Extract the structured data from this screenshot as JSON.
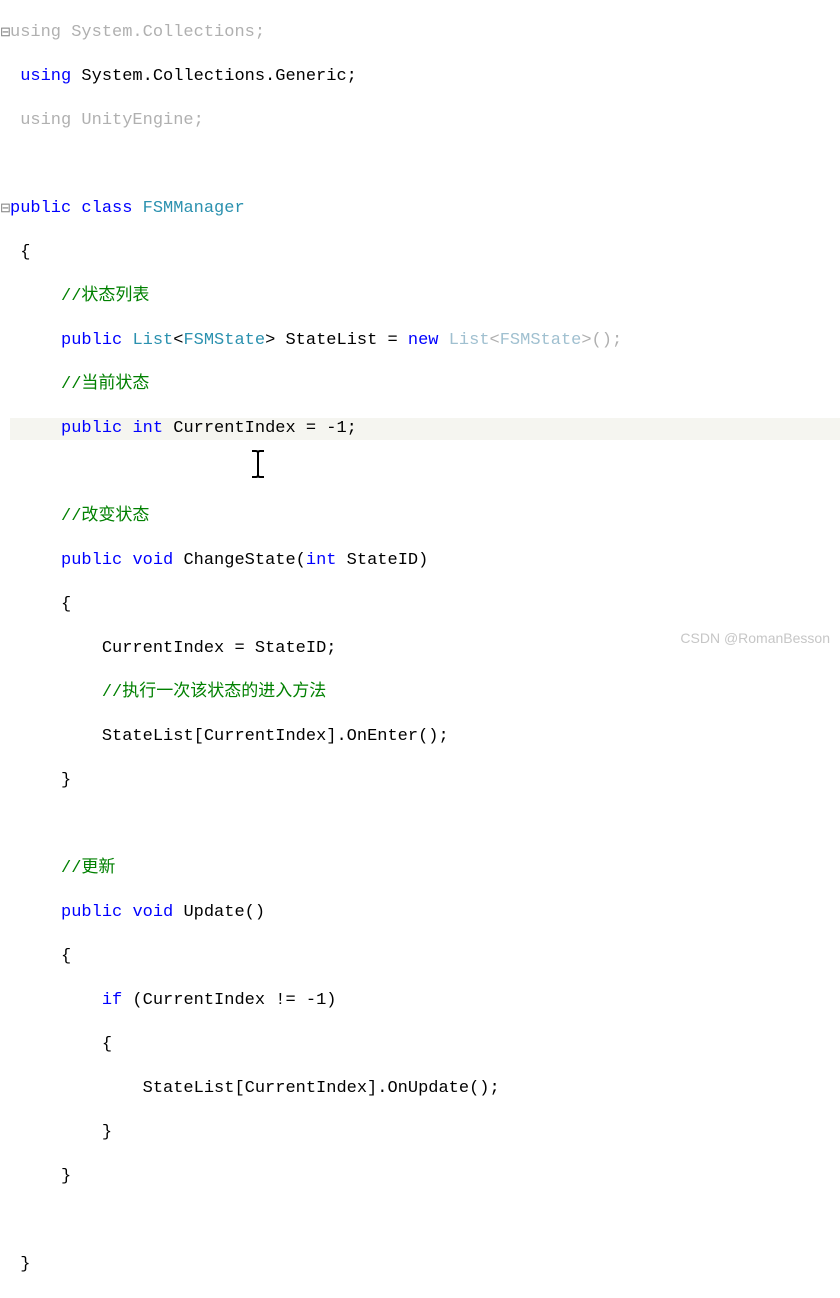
{
  "code": {
    "using1_kw": "using",
    "using1_ns": " System.Collections;",
    "using2_kw": "using",
    "using2_ns": " System.Collections.Generic;",
    "using3_kw": "using",
    "using3_ns": " UnityEngine;",
    "class_public": "public",
    "class_kw": " class ",
    "class_name": "FSMManager",
    "brace_open": "{",
    "comment1": "//状态列表",
    "field1_public": "public ",
    "field1_type": "List",
    "field1_lt": "<",
    "field1_generic": "FSMState",
    "field1_gt": "> StateList = ",
    "field1_new": "new",
    "field1_list": " List",
    "field1_lt2": "<",
    "field1_generic2": "FSMState",
    "field1_end": ">();",
    "comment2": "//当前状态",
    "field2_public": "public ",
    "field2_int": "int",
    "field2_rest": " CurrentIndex = -1;",
    "comment3": "//改变状态",
    "method1_public": "public ",
    "method1_void": "void",
    "method1_name": " ChangeState(",
    "method1_int": "int",
    "method1_param": " StateID)",
    "method1_body1": "CurrentIndex = StateID;",
    "method1_comment": "//执行一次该状态的进入方法",
    "method1_body2": "StateList[CurrentIndex].OnEnter();",
    "comment4": "//更新",
    "method2_public": "public ",
    "method2_void": "void",
    "method2_name": " Update()",
    "method2_if": "if",
    "method2_cond": " (CurrentIndex != -1)",
    "method2_body": "StateList[CurrentIndex].OnUpdate();",
    "brace_close": "}"
  },
  "watermark": "CSDN @RomanBesson"
}
